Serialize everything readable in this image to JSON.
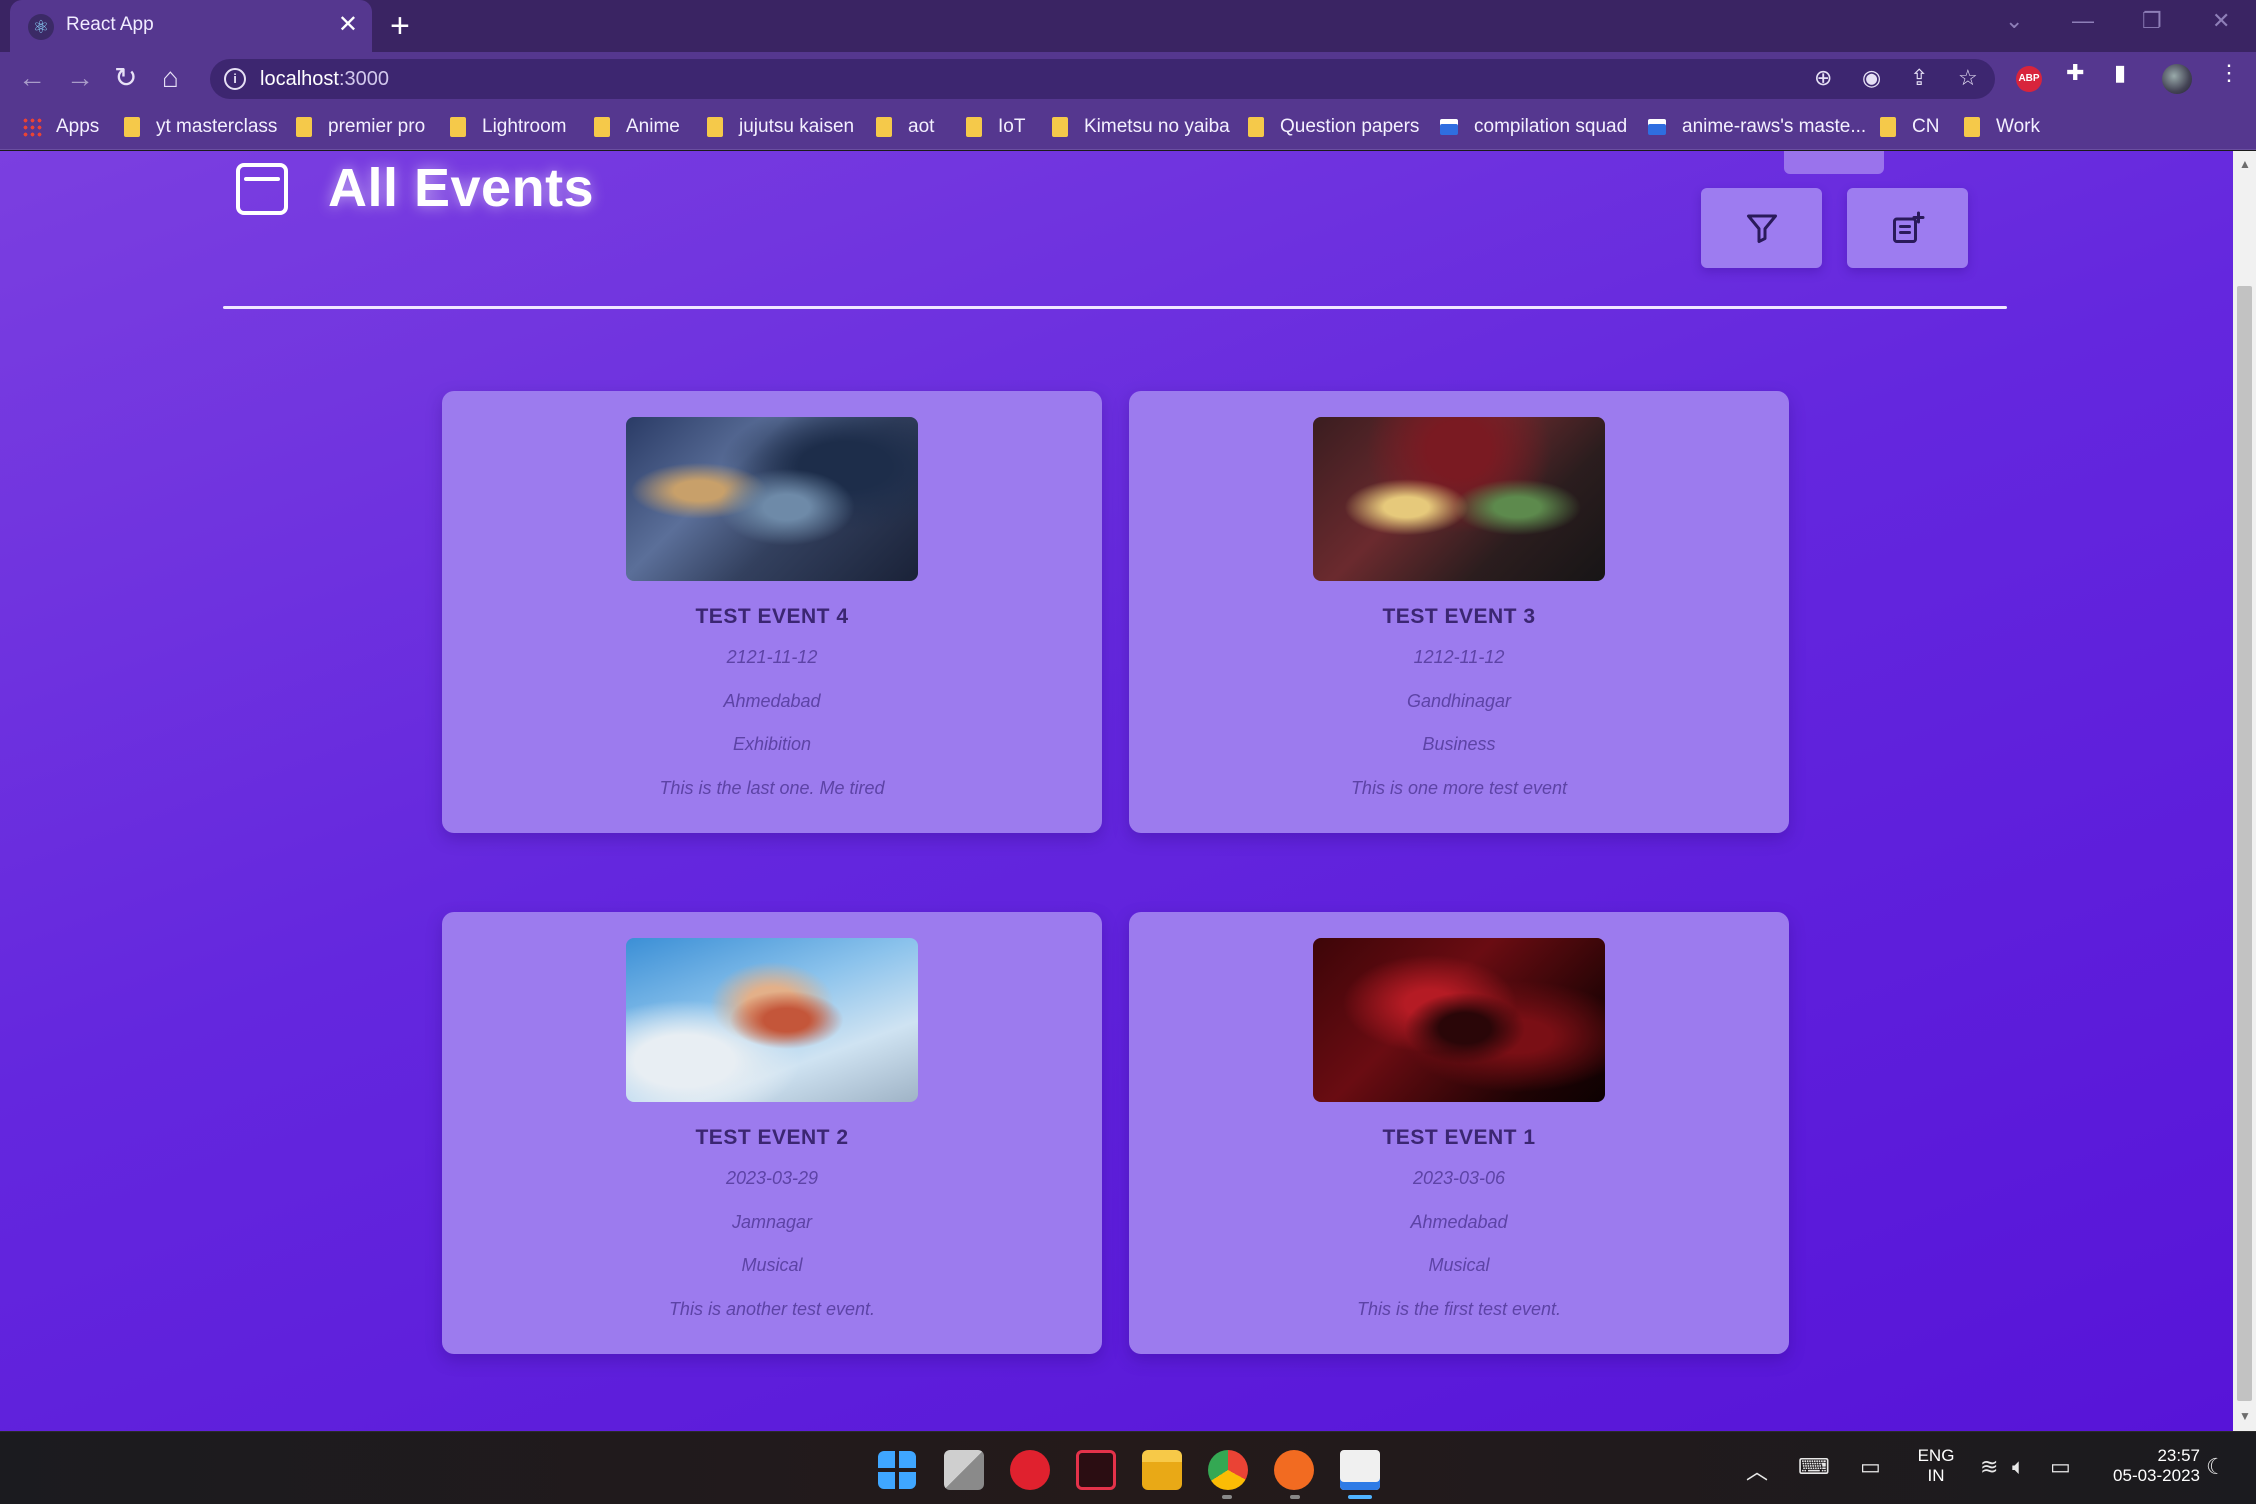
{
  "browser": {
    "tab_title": "React App",
    "tab_close": "✕",
    "new_tab": "+",
    "url_host": "localhost",
    "url_port": ":3000",
    "profile_ext": "ABP"
  },
  "bookmarks": [
    {
      "label": "Apps",
      "icon": "apps-grid-icon"
    },
    {
      "label": "yt masterclass",
      "icon": "folder-icon"
    },
    {
      "label": "premier pro",
      "icon": "folder-icon"
    },
    {
      "label": "Lightroom",
      "icon": "folder-icon"
    },
    {
      "label": "Anime",
      "icon": "folder-icon"
    },
    {
      "label": "jujutsu kaisen",
      "icon": "folder-icon"
    },
    {
      "label": "aot",
      "icon": "folder-icon"
    },
    {
      "label": "IoT",
      "icon": "folder-icon"
    },
    {
      "label": "Kimetsu no yaiba",
      "icon": "folder-icon"
    },
    {
      "label": "Question papers",
      "icon": "folder-icon"
    },
    {
      "label": "compilation squad",
      "icon": "site-icon"
    },
    {
      "label": "anime-raws's maste...",
      "icon": "site-icon"
    },
    {
      "label": "CN",
      "icon": "folder-icon"
    },
    {
      "label": "Work",
      "icon": "folder-icon"
    }
  ],
  "page": {
    "title": "All Events",
    "filter_icon": "filter-icon",
    "add_icon": "add-event-icon"
  },
  "events": [
    {
      "title": "TEST EVENT 4",
      "date": "2121-11-12",
      "city": "Ahmedabad",
      "category": "Exhibition",
      "description": "This is the last one. Me tired"
    },
    {
      "title": "TEST EVENT 3",
      "date": "1212-11-12",
      "city": "Gandhinagar",
      "category": "Business",
      "description": "This is one more test event"
    },
    {
      "title": "TEST EVENT 2",
      "date": "2023-03-29",
      "city": "Jamnagar",
      "category": "Musical",
      "description": "This is another test event."
    },
    {
      "title": "TEST EVENT 1",
      "date": "2023-03-06",
      "city": "Ahmedabad",
      "category": "Musical",
      "description": "This is the first test event."
    }
  ],
  "taskbar": {
    "language_top": "ENG",
    "language_bottom": "IN",
    "time": "23:57",
    "date": "05-03-2023"
  },
  "colors": {
    "page_gradient_start": "#7b3fe0",
    "page_gradient_end": "#5714d8",
    "card_background": "#9c7bee",
    "card_title": "#3b2672",
    "card_text": "#5d43a6"
  }
}
